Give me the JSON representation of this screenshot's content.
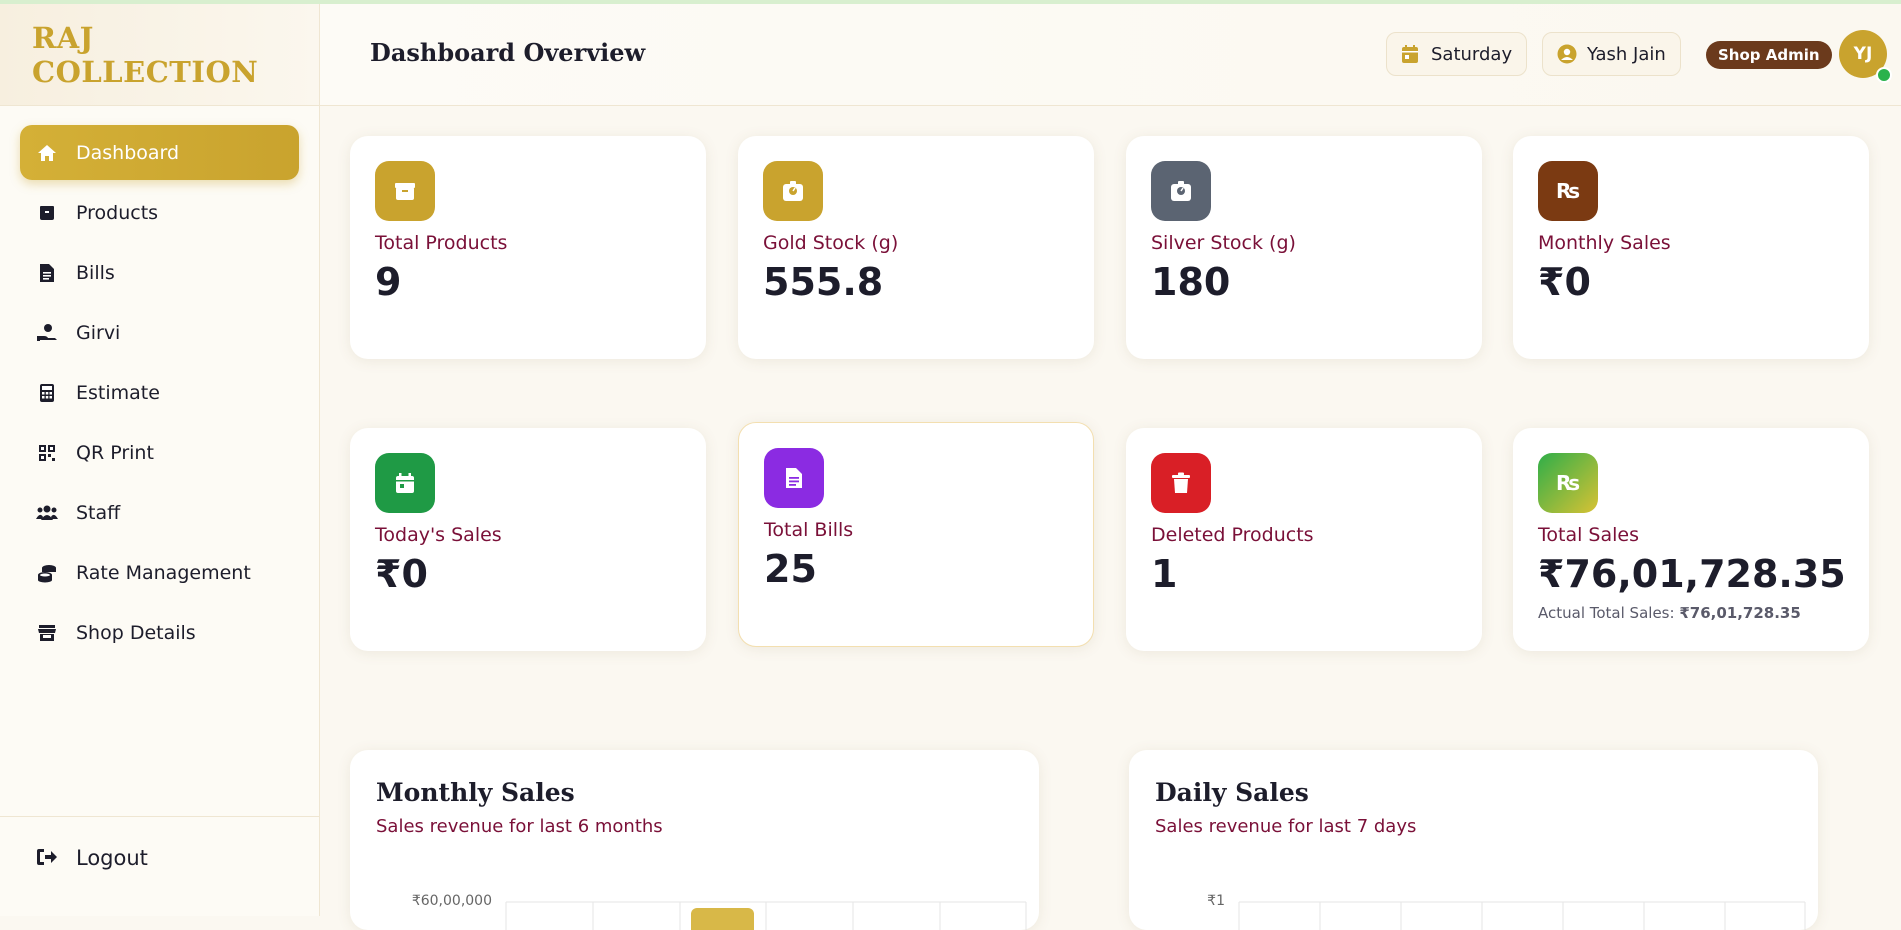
{
  "brand": "RAJ COLLECTION",
  "nav": [
    {
      "label": "Dashboard",
      "icon": "home-icon",
      "active": true
    },
    {
      "label": "Products",
      "icon": "box-icon"
    },
    {
      "label": "Bills",
      "icon": "file-invoice-icon"
    },
    {
      "label": "Girvi",
      "icon": "hand-coin-icon"
    },
    {
      "label": "Estimate",
      "icon": "calculator-icon"
    },
    {
      "label": "QR Print",
      "icon": "qr-code-icon"
    },
    {
      "label": "Staff",
      "icon": "users-icon"
    },
    {
      "label": "Rate Management",
      "icon": "coins-icon"
    },
    {
      "label": "Shop Details",
      "icon": "store-icon"
    }
  ],
  "logout_label": "Logout",
  "header": {
    "title": "Dashboard Overview",
    "day": "Saturday",
    "user_name": "Yash Jain",
    "role": "Shop Admin",
    "avatar_initials": "YJ"
  },
  "cards": [
    {
      "label": "Total Products",
      "value": "9",
      "icon": "box-icon",
      "color": "#c9a32e"
    },
    {
      "label": "Gold Stock (g)",
      "value": "555.8",
      "icon": "weight-scale-icon",
      "color": "#c9a32e"
    },
    {
      "label": "Silver Stock (g)",
      "value": "180",
      "icon": "weight-scale-icon",
      "color": "#5b6472"
    },
    {
      "label": "Monthly Sales",
      "value": "₹0",
      "icon": "rupee-icon",
      "color": "#7b3a12"
    },
    {
      "label": "Today's Sales",
      "value": "₹0",
      "icon": "calendar-icon",
      "color": "#1f9a45"
    },
    {
      "label": "Total Bills",
      "value": "25",
      "icon": "file-invoice-icon",
      "color": "#8b2be2"
    },
    {
      "label": "Deleted Products",
      "value": "1",
      "icon": "trash-icon",
      "color": "#d91f26"
    },
    {
      "label": "Total Sales",
      "value": "₹76,01,728.35",
      "icon": "rupee-icon",
      "color": "#3fae49",
      "sub_label": "Actual Total Sales:",
      "sub_value": "₹76,01,728.35"
    }
  ],
  "charts": {
    "monthly": {
      "title": "Monthly Sales",
      "subtitle": "Sales revenue for last 6 months",
      "y_tick": "₹60,00,000"
    },
    "daily": {
      "title": "Daily Sales",
      "subtitle": "Sales revenue for last 7 days",
      "y_tick": "₹1"
    }
  },
  "colors": {
    "gold": "#c9a32e",
    "maroon": "#7a1038",
    "brown": "#6b3a1c"
  }
}
